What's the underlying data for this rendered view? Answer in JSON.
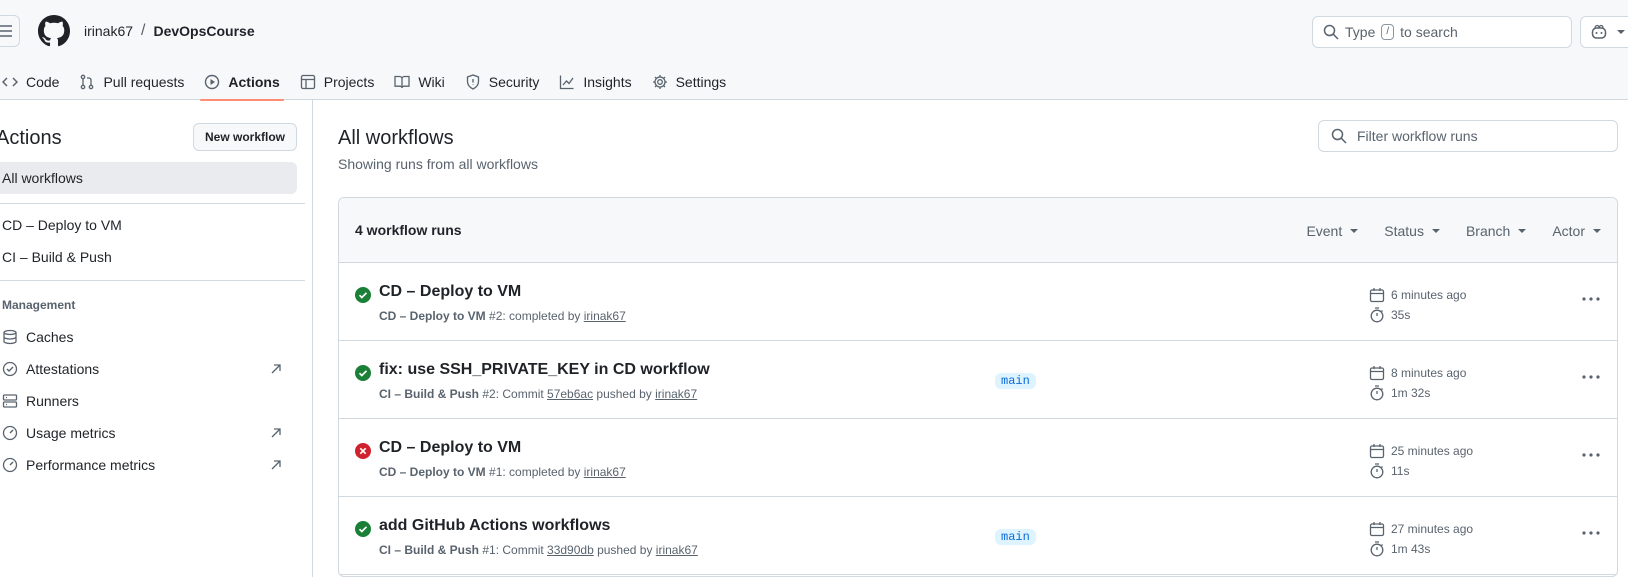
{
  "header": {
    "owner": "irinak67",
    "separator": "/",
    "repo": "DevOpsCourse",
    "search": {
      "prefix": "Type",
      "key": "/",
      "suffix": "to search"
    }
  },
  "tabs": [
    {
      "label": "Code",
      "icon": "code-icon"
    },
    {
      "label": "Pull requests",
      "icon": "pull-request-icon"
    },
    {
      "label": "Actions",
      "icon": "play-icon",
      "active": true
    },
    {
      "label": "Projects",
      "icon": "table-icon"
    },
    {
      "label": "Wiki",
      "icon": "book-icon"
    },
    {
      "label": "Security",
      "icon": "shield-icon"
    },
    {
      "label": "Insights",
      "icon": "graph-icon"
    },
    {
      "label": "Settings",
      "icon": "gear-icon"
    }
  ],
  "sidebar": {
    "title": "Actions",
    "new_workflow": "New workflow",
    "all_workflows": "All workflows",
    "workflows": [
      "CD – Deploy to VM",
      "CI – Build & Push"
    ],
    "management_heading": "Management",
    "management": [
      {
        "label": "Caches",
        "icon": "database-icon",
        "external": false
      },
      {
        "label": "Attestations",
        "icon": "verified-icon",
        "external": true
      },
      {
        "label": "Runners",
        "icon": "server-icon",
        "external": false
      },
      {
        "label": "Usage metrics",
        "icon": "meter-icon",
        "external": true
      },
      {
        "label": "Performance metrics",
        "icon": "meter-icon",
        "external": true
      }
    ]
  },
  "main": {
    "title": "All workflows",
    "subtitle": "Showing runs from all workflows",
    "filter_placeholder": "Filter workflow runs",
    "count": "4 workflow runs",
    "filters": [
      "Event",
      "Status",
      "Branch",
      "Actor"
    ],
    "runs": [
      {
        "status": "success",
        "title": "CD – Deploy to VM",
        "workflow": "CD – Deploy to VM",
        "detail": " #2: completed by ",
        "user": "irinak67",
        "branch": "",
        "time": "6 minutes ago",
        "duration": "35s"
      },
      {
        "status": "success",
        "title": "fix: use SSH_PRIVATE_KEY in CD workflow",
        "workflow": "CI – Build & Push",
        "detail": " #2: Commit ",
        "commit": "57eb6ac",
        "detail2": " pushed by ",
        "user": "irinak67",
        "branch": "main",
        "time": "8 minutes ago",
        "duration": "1m 32s"
      },
      {
        "status": "failure",
        "title": "CD – Deploy to VM",
        "workflow": "CD – Deploy to VM",
        "detail": " #1: completed by ",
        "user": "irinak67",
        "branch": "",
        "time": "25 minutes ago",
        "duration": "11s"
      },
      {
        "status": "success",
        "title": "add GitHub Actions workflows",
        "workflow": "CI – Build & Push",
        "detail": " #1: Commit ",
        "commit": "33d90db",
        "detail2": " pushed by ",
        "user": "irinak67",
        "branch": "main",
        "time": "27 minutes ago",
        "duration": "1m 43s"
      }
    ]
  },
  "colors": {
    "success": "#1a7f37",
    "failure": "#cf222e",
    "tab_underline": "#fd8c73",
    "branch_bg": "#ddf4ff",
    "branch_fg": "#0969da"
  }
}
